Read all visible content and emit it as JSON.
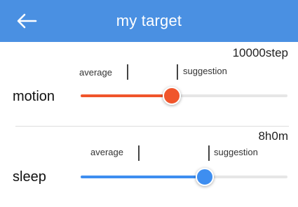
{
  "header": {
    "title": "my target",
    "back_icon": "arrow-left-icon"
  },
  "colors": {
    "header_bg": "#4a90e2",
    "motion_accent": "#f0552b",
    "sleep_accent": "#3e8ef0",
    "track_bg": "#e6e6e6"
  },
  "motion": {
    "label": "motion",
    "value": "10000step",
    "average_label": "average",
    "suggestion_label": "suggestion",
    "slider_fraction": 0.44
  },
  "sleep": {
    "label": "sleep",
    "value": "8h0m",
    "average_label": "average",
    "suggestion_label": "suggestion",
    "slider_fraction": 0.6
  }
}
